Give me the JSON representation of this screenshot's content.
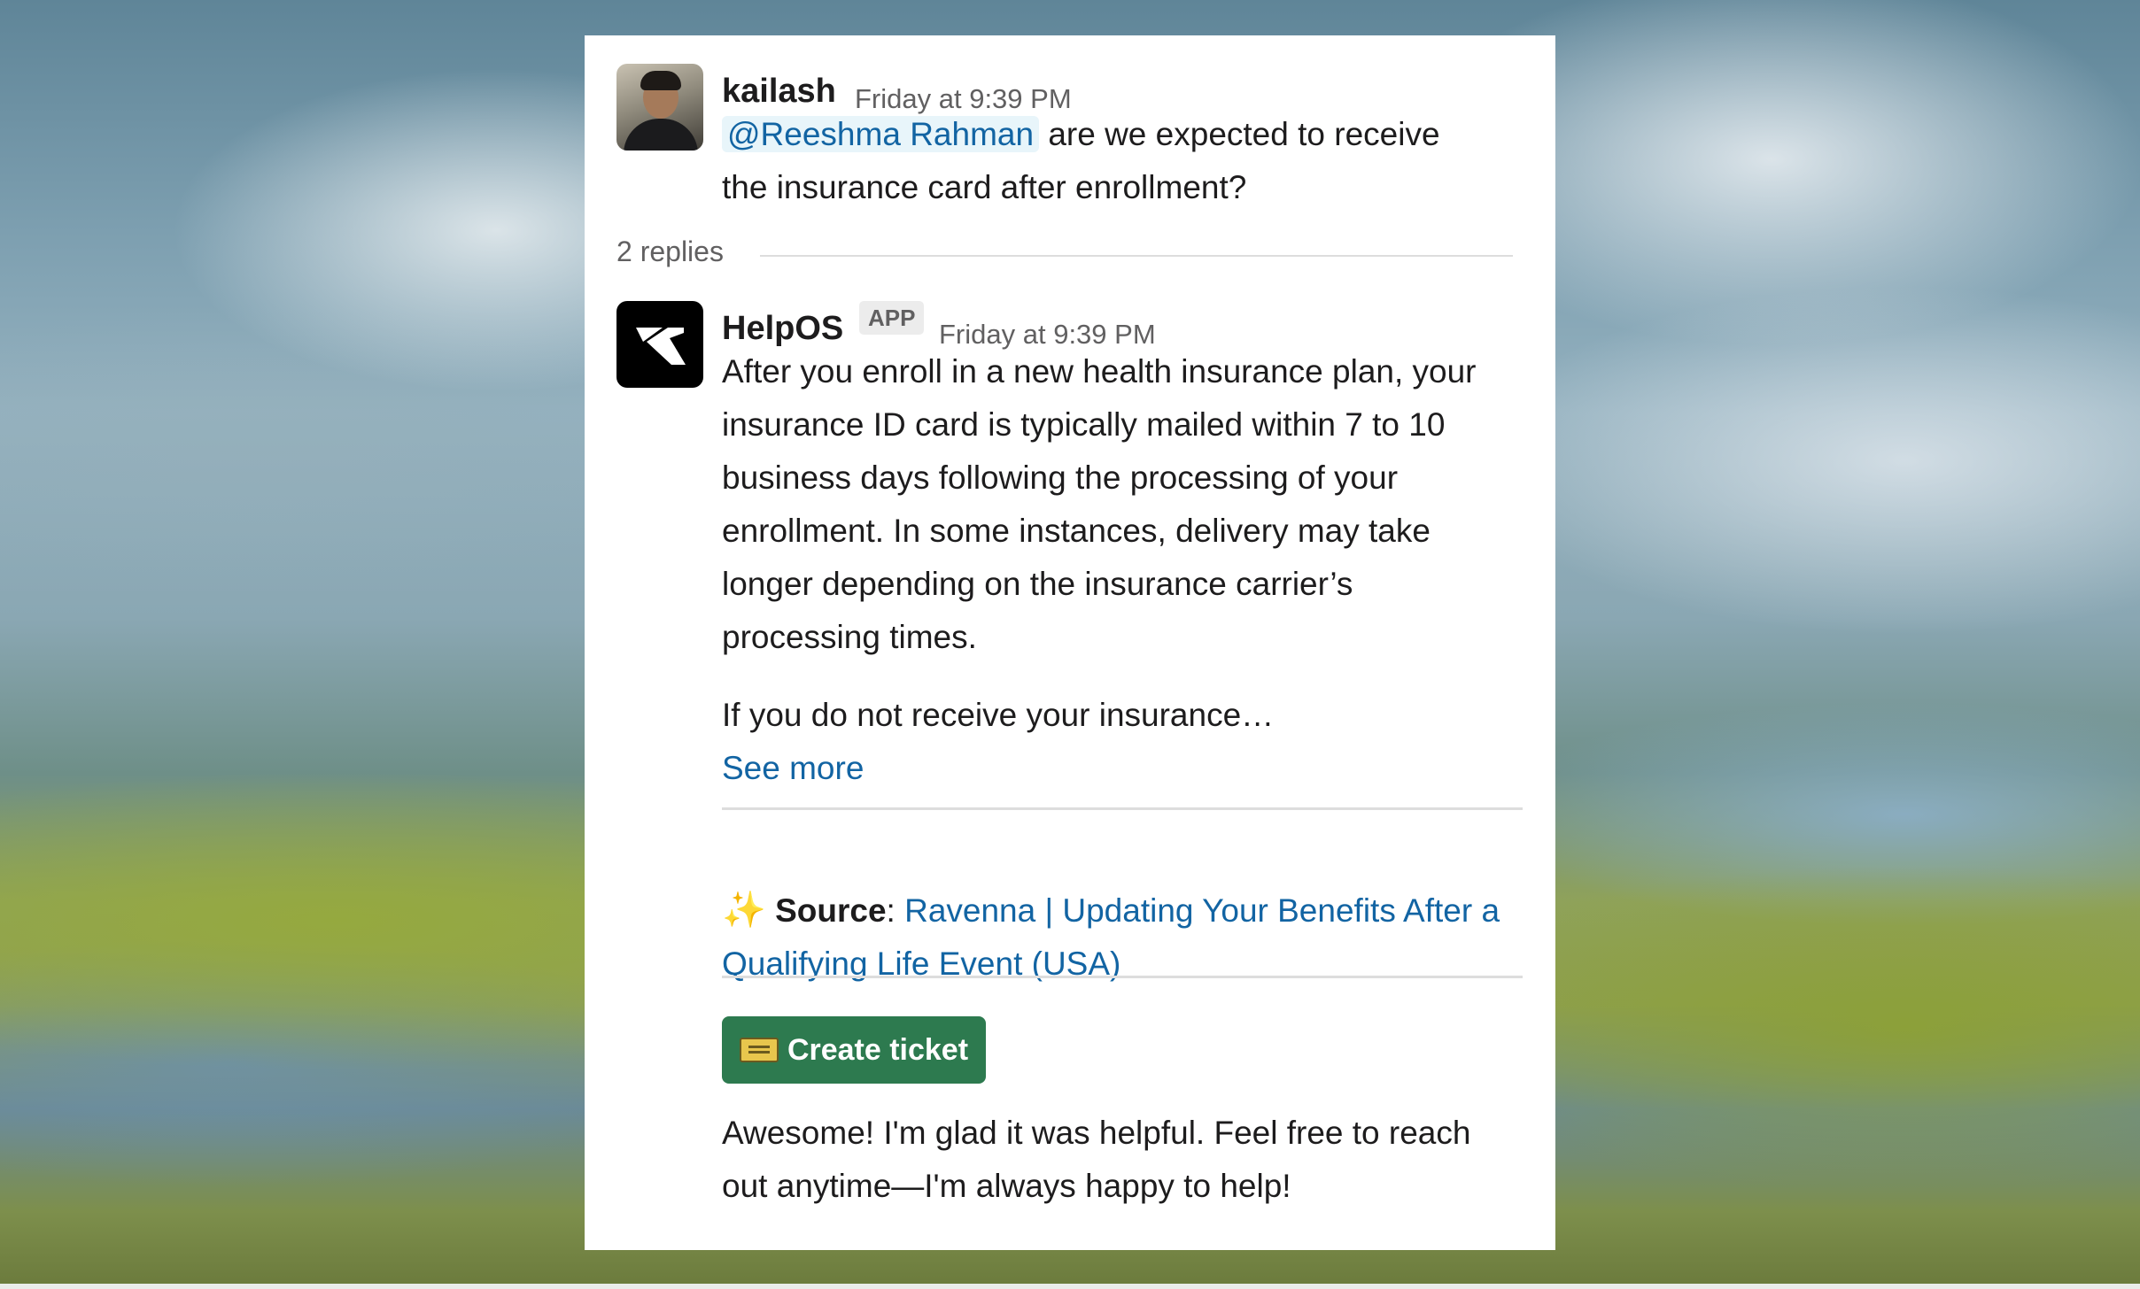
{
  "thread": {
    "parent": {
      "author": "kailash",
      "timestamp": "Friday at 9:39 PM",
      "mention": "@Reeshma Rahman",
      "text_line1": " are we expected to receive",
      "text_line2": "the insurance card after enrollment?"
    },
    "replies_count": "2 replies",
    "reply": {
      "author": "HelpOS",
      "badge": "APP",
      "timestamp": "Friday at 9:39 PM",
      "paragraph": "After you enroll in a new health insurance plan, your insurance ID card is typically mailed within 7 to 10 business days following the processing of your enrollment. In some instances, delivery may take longer depending on the insurance carrier’s processing times.",
      "truncated_line": "If you do not receive your insurance…",
      "see_more": "See more",
      "source_icon": "sparkles-icon",
      "source_label": "Source",
      "source_colon": ": ",
      "source_link": "Ravenna | Updating Your Benefits After a Qualifying Life Event (USA)",
      "ticket_icon": "ticket-icon",
      "create_ticket_label": "Create ticket",
      "followup": "Awesome! I'm glad it was helpful. Feel free to reach out anytime—I'm always happy to help!"
    }
  },
  "colors": {
    "link": "#1264a3",
    "button_bg": "#2d7a4f",
    "text": "#1d1c1d",
    "muted": "#616061",
    "mention_bg": "#e8f5fa"
  }
}
